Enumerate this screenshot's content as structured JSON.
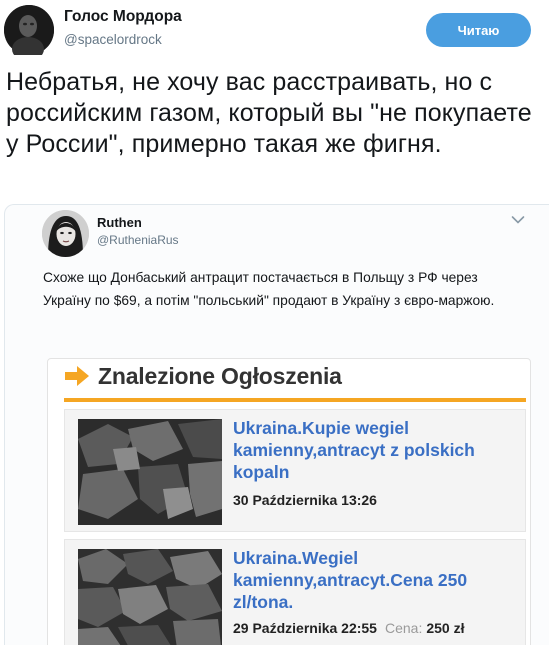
{
  "author": {
    "name": "Голос Мордора",
    "handle": "@spacelordrock",
    "avatar_icon": "dark-portrait-avatar"
  },
  "follow_button": {
    "label": "Читаю",
    "color": "#4a9ee0"
  },
  "tweet": {
    "text": "Небратья, не хочу вас расстраивать, но с российским газом, который вы \"не покупаете у России\", примерно такая же фигня."
  },
  "quoted_tweet": {
    "name": "Ruthen",
    "handle": "@RutheniaRus",
    "menu_icon": "chevron-down-icon",
    "text": "Схоже що Донбаський антрацит постачається в Польщу з РФ через Україну по $69, а потім \"польський\" продают в Україну з євро-маржою.",
    "embedded_screenshot": {
      "header_icon": "orange-arrow-icon",
      "title": "Znalezione Ogłoszenia",
      "accent_color": "#f5a623",
      "link_color": "#3a6fc4",
      "listings": [
        {
          "title": "Ukraina.Kupie wegiel kamienny,antracyt z polskich kopaln",
          "date": "30 Października 13:26"
        },
        {
          "title": "Ukraina.Wegiel kamienny,antracyt.Cena 250 zl/tona.",
          "date": "29 Października 22:55",
          "price_label": "Cena:",
          "price": "250 zł"
        }
      ]
    }
  }
}
